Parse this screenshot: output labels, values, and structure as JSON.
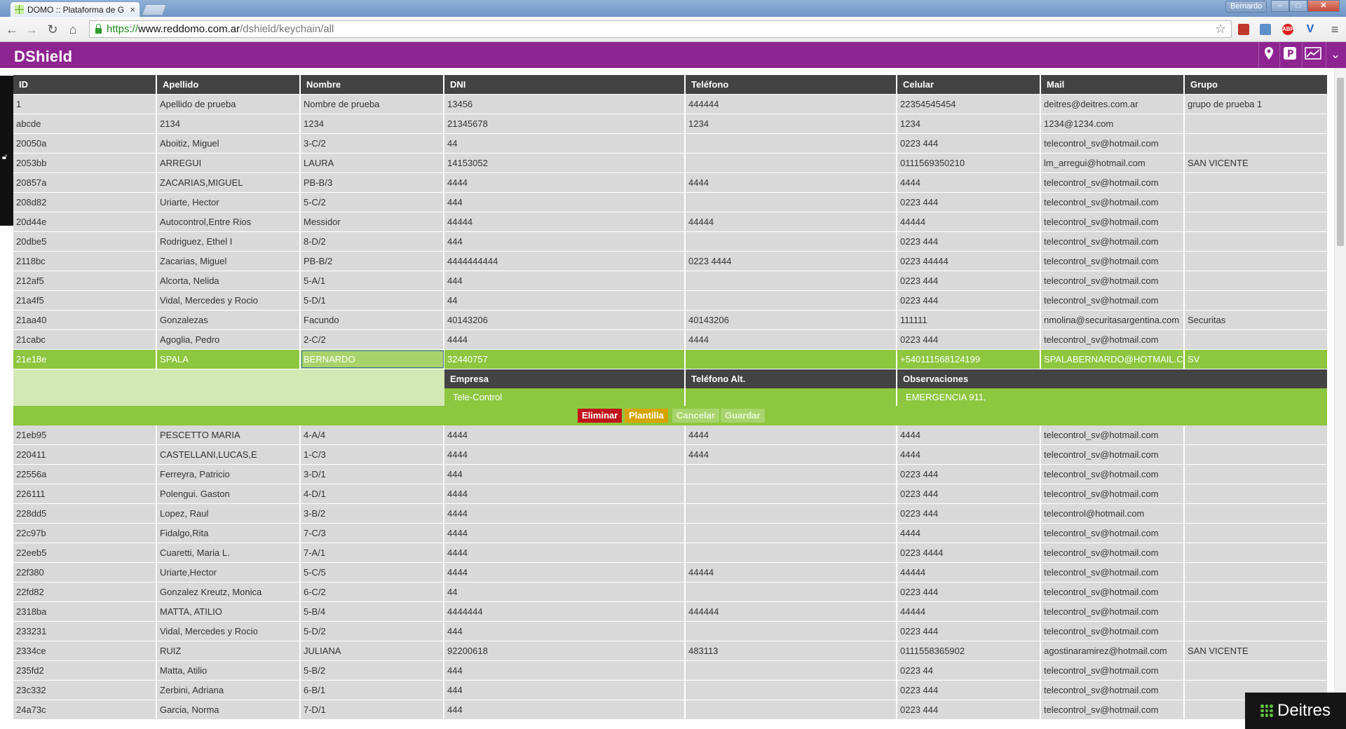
{
  "browser": {
    "tab_title": "DOMO :: Plataforma de G",
    "tab_close": "×",
    "user": "Bernardo",
    "url_scheme": "https://",
    "url_host": "www.reddomo.com.ar",
    "url_path": "/dshield/keychain/all",
    "nav_icons": [
      "back-icon",
      "forward-icon",
      "reload-icon",
      "home-icon"
    ],
    "extensions": [
      {
        "name": "bookmark-ext-icon",
        "color": "#c0392b",
        "label": ""
      },
      {
        "name": "cloud-ext-icon",
        "color": "#5b8fc9",
        "label": ""
      },
      {
        "name": "adblock-icon",
        "color": "#e01b1b",
        "label": "ABP"
      },
      {
        "name": "vpn-ext-icon",
        "color": "#1e62c8",
        "label": "V"
      }
    ]
  },
  "app": {
    "brand": "DShield",
    "header_icons": [
      "location-pin-icon",
      "parking-icon",
      "chart-icon",
      "chevron-down-icon"
    ],
    "colors": {
      "header": "#8e2492",
      "selected_row": "#8dc63f",
      "table_header": "#434343"
    }
  },
  "table": {
    "columns": [
      "ID",
      "Apellido",
      "Nombre",
      "DNI",
      "Teléfono",
      "Celular",
      "Mail",
      "Grupo"
    ],
    "rows_top": [
      [
        "1",
        "Apellido de prueba",
        "Nombre de prueba",
        "13456",
        "444444",
        "22354545454",
        "deitres@deitres.com.ar",
        "grupo de prueba 1"
      ],
      [
        "abcde",
        "2134",
        "1234",
        "21345678",
        "1234",
        "1234",
        "1234@1234.com",
        ""
      ],
      [
        "20050a",
        "Aboitiz, Miguel",
        "3-C/2",
        "44",
        "",
        "0223 444",
        "telecontrol_sv@hotmail.com",
        ""
      ],
      [
        "2053bb",
        "ARREGUI",
        "LAURA",
        "14153052",
        "",
        "0111569350210",
        "lm_arregui@hotmail.com",
        "SAN VICENTE"
      ],
      [
        "20857a",
        "ZACARIAS,MIGUEL",
        "PB-B/3",
        "4444",
        "4444",
        "4444",
        "telecontrol_sv@hotmail.com",
        ""
      ],
      [
        "208d82",
        "Uriarte, Hector",
        "5-C/2",
        "444",
        "",
        "0223 444",
        "telecontrol_sv@hotmail.com",
        ""
      ],
      [
        "20d44e",
        "Autocontrol,Entre Rios",
        "Messidor",
        "44444",
        "44444",
        "44444",
        "telecontrol_sv@hotmail.com",
        ""
      ],
      [
        "20dbe5",
        "Rodriguez, Ethel I",
        "8-D/2",
        "444",
        "",
        "0223 444",
        "telecontrol_sv@hotmail.com",
        ""
      ],
      [
        "2118bc",
        "Zacarias, Miguel",
        "PB-B/2",
        "4444444444",
        "0223 4444",
        "0223 44444",
        "telecontrol_sv@hotmail.com",
        ""
      ],
      [
        "212af5",
        "Alcorta, Nelida",
        "5-A/1",
        "444",
        "",
        "0223 444",
        "telecontrol_sv@hotmail.com",
        ""
      ],
      [
        "21a4f5",
        "Vidal, Mercedes y Rocio",
        "5-D/1",
        "44",
        "",
        "0223 444",
        "telecontrol_sv@hotmail.com",
        ""
      ],
      [
        "21aa40",
        "Gonzalezas",
        "Facundo",
        "40143206",
        "40143206",
        "111111",
        "nmolina@securitasargentina.com",
        "Securitas"
      ],
      [
        "21cabc",
        "Agoglia, Pedro",
        "2-C/2",
        "4444",
        "4444",
        "0223 444",
        "telecontrol_sv@hotmail.com",
        ""
      ]
    ],
    "selected": {
      "cells": [
        "21e18e",
        "SPALA",
        "BERNARDO",
        "32440757",
        "",
        "+540111568124199",
        "SPALABERNARDO@HOTMAIL.C",
        "SV"
      ],
      "detail_headers": [
        "Empresa",
        "Teléfono Alt.",
        "Observaciones"
      ],
      "detail_values": [
        "Tele-Control",
        "",
        "EMERGENCIA 911,"
      ],
      "buttons": {
        "delete": "Eliminar",
        "template": "Plantilla",
        "cancel": "Cancelar",
        "save": "Guardar"
      }
    },
    "rows_bottom": [
      [
        "21eb95",
        "PESCETTO MARIA",
        "4-A/4",
        "4444",
        "4444",
        "4444",
        "telecontrol_sv@hotmail.com",
        ""
      ],
      [
        "220411",
        "CASTELLANI,LUCAS,E",
        "1-C/3",
        "4444",
        "4444",
        "4444",
        "telecontrol_sv@hotmail.com",
        ""
      ],
      [
        "22556a",
        "Ferreyra, Patricio",
        "3-D/1",
        "444",
        "",
        "0223 444",
        "telecontrol_sv@hotmail.com",
        ""
      ],
      [
        "226111",
        "Polengui. Gaston",
        "4-D/1",
        "4444",
        "",
        "0223 444",
        "telecontrol_sv@hotmail.com",
        ""
      ],
      [
        "228dd5",
        "Lopez, Raul",
        "3-B/2",
        "4444",
        "",
        "0223 444",
        "telecontrol@hotmail.com",
        ""
      ],
      [
        "22c97b",
        "Fidalgo,Rita",
        "7-C/3",
        "4444",
        "",
        "4444",
        "telecontrol_sv@hotmail.com",
        ""
      ],
      [
        "22eeb5",
        "Cuaretti, Maria L.",
        "7-A/1",
        "4444",
        "",
        "0223 4444",
        "telecontrol_sv@hotmail.com",
        ""
      ],
      [
        "22f380",
        "Uriarte,Hector",
        "5-C/5",
        "4444",
        "44444",
        "44444",
        "telecontrol_sv@hotmail.com",
        ""
      ],
      [
        "22fd82",
        "Gonzalez Kreutz, Monica",
        "6-C/2",
        "44",
        "",
        "0223 444",
        "telecontrol_sv@hotmail.com",
        ""
      ],
      [
        "2318ba",
        "MATTA, ATILIO",
        "5-B/4",
        "4444444",
        "444444",
        "44444",
        "telecontrol_sv@hotmail.com",
        ""
      ],
      [
        "233231",
        "Vidal, Mercedes y Rocio",
        "5-D/2",
        "444",
        "",
        "0223 444",
        "telecontrol_sv@hotmail.com",
        ""
      ],
      [
        "2334ce",
        "RUIZ",
        "JULIANA",
        "92200618",
        "483113",
        "0111558365902",
        "agostinaramirez@hotmail.com",
        "SAN VICENTE"
      ],
      [
        "235fd2",
        "Matta, Atilio",
        "5-B/2",
        "444",
        "",
        "0223 44",
        "telecontrol_sv@hotmail.com",
        ""
      ],
      [
        "23c332",
        "Zerbini, Adriana",
        "6-B/1",
        "444",
        "",
        "0223 444",
        "telecontrol_sv@hotmail.com",
        ""
      ],
      [
        "24a73c",
        "Garcia, Norma",
        "7-D/1",
        "444",
        "",
        "0223 444",
        "telecontrol_sv@hotmail.com",
        ""
      ]
    ]
  },
  "badge": {
    "text": "Deitres"
  }
}
